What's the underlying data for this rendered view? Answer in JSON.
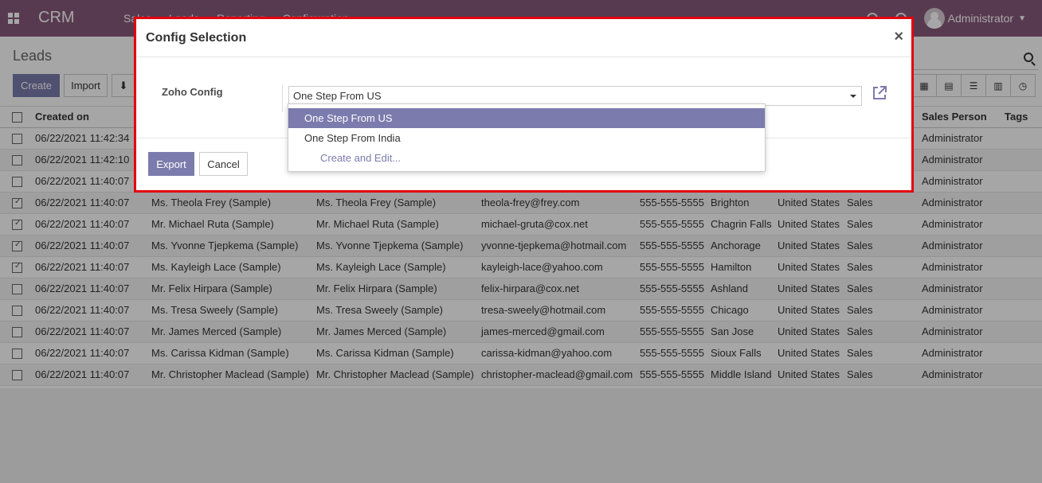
{
  "navbar": {
    "brand": "CRM",
    "menu": [
      "Sales",
      "Leads",
      "Reporting",
      "Configuration"
    ],
    "user": "Administrator"
  },
  "control_panel": {
    "title": "Leads",
    "create_label": "Create",
    "import_label": "Import"
  },
  "table": {
    "headers": [
      "Created on",
      "",
      "",
      "",
      "",
      "",
      "",
      "",
      "Sales Person",
      "Tags"
    ],
    "rows": [
      {
        "checked": false,
        "created": "06/22/2021 11:42:34",
        "name": "",
        "contact": "",
        "email": "",
        "phone": "",
        "city": "",
        "country": "",
        "team": "",
        "salesperson": "Administrator"
      },
      {
        "checked": false,
        "created": "06/22/2021 11:42:10",
        "name": "",
        "contact": "",
        "email": "",
        "phone": "",
        "city": "",
        "country": "",
        "team": "",
        "salesperson": "Administrator"
      },
      {
        "checked": false,
        "created": "06/22/2021 11:40:07",
        "name": "",
        "contact": "",
        "email": "",
        "phone": "",
        "city": "",
        "country": "",
        "team": "",
        "salesperson": "Administrator"
      },
      {
        "checked": true,
        "created": "06/22/2021 11:40:07",
        "name": "Ms. Theola Frey (Sample)",
        "contact": "Ms. Theola Frey (Sample)",
        "email": "theola-frey@frey.com",
        "phone": "555-555-5555",
        "city": "Brighton",
        "country": "United States",
        "team": "Sales",
        "salesperson": "Administrator"
      },
      {
        "checked": true,
        "created": "06/22/2021 11:40:07",
        "name": "Mr. Michael Ruta (Sample)",
        "contact": "Mr. Michael Ruta (Sample)",
        "email": "michael-gruta@cox.net",
        "phone": "555-555-5555",
        "city": "Chagrin Falls",
        "country": "United States",
        "team": "Sales",
        "salesperson": "Administrator"
      },
      {
        "checked": true,
        "created": "06/22/2021 11:40:07",
        "name": "Ms. Yvonne Tjepkema (Sample)",
        "contact": "Ms. Yvonne Tjepkema (Sample)",
        "email": "yvonne-tjepkema@hotmail.com",
        "phone": "555-555-5555",
        "city": "Anchorage",
        "country": "United States",
        "team": "Sales",
        "salesperson": "Administrator"
      },
      {
        "checked": true,
        "created": "06/22/2021 11:40:07",
        "name": "Ms. Kayleigh Lace (Sample)",
        "contact": "Ms. Kayleigh Lace (Sample)",
        "email": "kayleigh-lace@yahoo.com",
        "phone": "555-555-5555",
        "city": "Hamilton",
        "country": "United States",
        "team": "Sales",
        "salesperson": "Administrator"
      },
      {
        "checked": false,
        "created": "06/22/2021 11:40:07",
        "name": "Mr. Felix Hirpara (Sample)",
        "contact": "Mr. Felix Hirpara (Sample)",
        "email": "felix-hirpara@cox.net",
        "phone": "555-555-5555",
        "city": "Ashland",
        "country": "United States",
        "team": "Sales",
        "salesperson": "Administrator"
      },
      {
        "checked": false,
        "created": "06/22/2021 11:40:07",
        "name": "Ms. Tresa Sweely (Sample)",
        "contact": "Ms. Tresa Sweely (Sample)",
        "email": "tresa-sweely@hotmail.com",
        "phone": "555-555-5555",
        "city": "Chicago",
        "country": "United States",
        "team": "Sales",
        "salesperson": "Administrator"
      },
      {
        "checked": false,
        "created": "06/22/2021 11:40:07",
        "name": "Mr. James Merced (Sample)",
        "contact": "Mr. James Merced (Sample)",
        "email": "james-merced@gmail.com",
        "phone": "555-555-5555",
        "city": "San Jose",
        "country": "United States",
        "team": "Sales",
        "salesperson": "Administrator"
      },
      {
        "checked": false,
        "created": "06/22/2021 11:40:07",
        "name": "Ms. Carissa Kidman (Sample)",
        "contact": "Ms. Carissa Kidman (Sample)",
        "email": "carissa-kidman@yahoo.com",
        "phone": "555-555-5555",
        "city": "Sioux Falls",
        "country": "United States",
        "team": "Sales",
        "salesperson": "Administrator"
      },
      {
        "checked": false,
        "created": "06/22/2021 11:40:07",
        "name": "Mr. Christopher Maclead (Sample)",
        "contact": "Mr. Christopher Maclead (Sample)",
        "email": "christopher-maclead@gmail.com",
        "phone": "555-555-5555",
        "city": "Middle Island",
        "country": "United States",
        "team": "Sales",
        "salesperson": "Administrator"
      }
    ]
  },
  "modal": {
    "title": "Config Selection",
    "close": "×",
    "field_label": "Zoho Config",
    "selected_value": "One Step From US",
    "options": [
      "One Step From US",
      "One Step From India"
    ],
    "create_edit": "Create and Edit...",
    "export_label": "Export",
    "cancel_label": "Cancel"
  },
  "colors": {
    "brand": "#875a7b",
    "primary_button": "#7c7bad",
    "highlight_border": "#e3000f"
  }
}
